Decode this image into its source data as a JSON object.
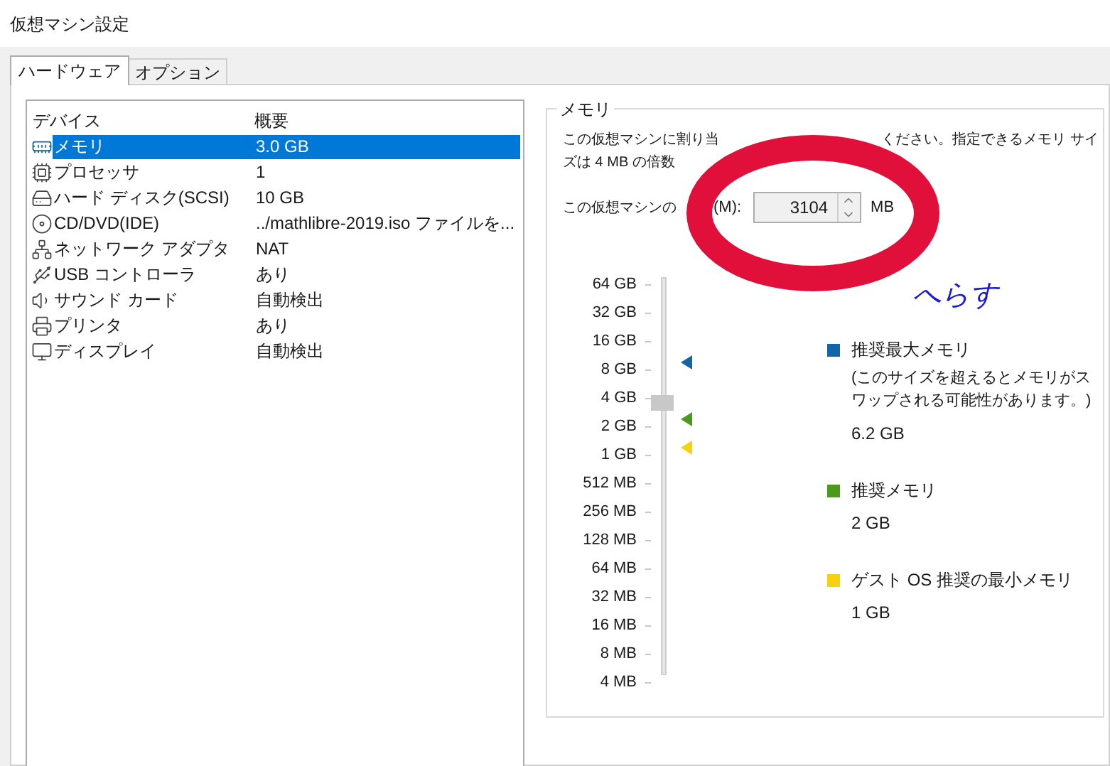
{
  "window": {
    "title": "仮想マシン設定"
  },
  "tabs": [
    {
      "label": "ハードウェア",
      "selected": true
    },
    {
      "label": "オプション",
      "selected": false
    }
  ],
  "device_table": {
    "columns": [
      "デバイス",
      "概要"
    ],
    "rows": [
      {
        "kind": "memory",
        "device": "メモリ",
        "summary": "3.0 GB",
        "selected": true
      },
      {
        "kind": "processor",
        "device": "プロセッサ",
        "summary": "1",
        "selected": false
      },
      {
        "kind": "disk",
        "device": "ハード ディスク(SCSI)",
        "summary": "10 GB",
        "selected": false
      },
      {
        "kind": "cd",
        "device": "CD/DVD(IDE)",
        "summary": "../mathlibre-2019.iso ファイルを...",
        "selected": false
      },
      {
        "kind": "network",
        "device": "ネットワーク アダプタ",
        "summary": "NAT",
        "selected": false
      },
      {
        "kind": "usb",
        "device": "USB コントローラ",
        "summary": "あり",
        "selected": false
      },
      {
        "kind": "sound",
        "device": "サウンド カード",
        "summary": "自動検出",
        "selected": false
      },
      {
        "kind": "printer",
        "device": "プリンタ",
        "summary": "あり",
        "selected": false
      },
      {
        "kind": "display",
        "device": "ディスプレイ",
        "summary": "自動検出",
        "selected": false
      }
    ]
  },
  "memory": {
    "title": "メモリ",
    "description": [
      "この仮想マシンに割り当",
      "ください。指定できるメモリ サイ",
      "ズは 4 MB の倍数"
    ],
    "field_label": [
      "この仮想マシンの",
      "(M):"
    ],
    "value": "3104",
    "unit": "MB",
    "slider": {
      "level": 0.686,
      "ticks": [
        "64 GB",
        "32 GB",
        "16 GB",
        "8 GB",
        "4 GB",
        "2 GB",
        "1 GB",
        "512 MB",
        "256 MB",
        "128 MB",
        "64 MB",
        "32 MB",
        "16 MB",
        "8 MB",
        "4 MB"
      ],
      "markers": [
        {
          "level": 0.786,
          "color": "#1464a8"
        },
        {
          "level": 0.643,
          "color": "#4a9a1c"
        },
        {
          "level": 0.571,
          "color": "#f5d20c"
        }
      ]
    },
    "legend": [
      {
        "color": "#1464a8",
        "title": "推奨最大メモリ",
        "note": "(このサイズを超えるとメモリがスワップされる可能性があります。)",
        "value": "6.2 GB"
      },
      {
        "color": "#4a9a1c",
        "title": "推奨メモリ",
        "value": "2 GB"
      },
      {
        "color": "#f5d20c",
        "title": "ゲスト OS 推奨の最小メモリ",
        "value": "1 GB"
      }
    ]
  },
  "annotation": {
    "handwritten_note": "へらす"
  }
}
